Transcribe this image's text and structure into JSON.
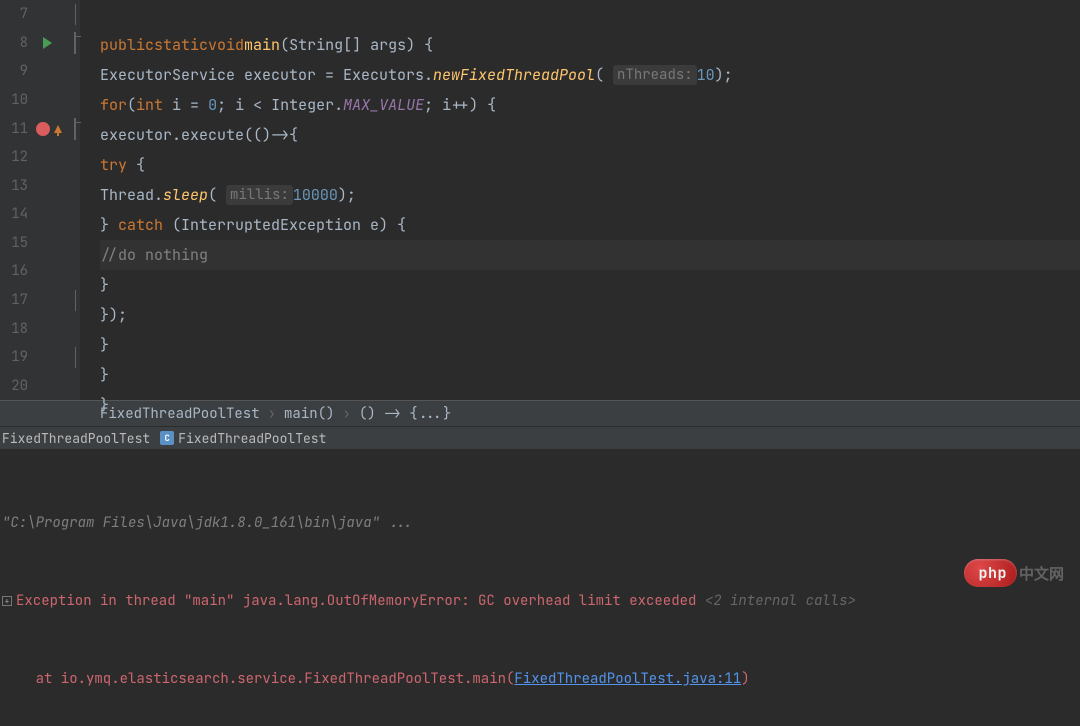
{
  "lines": {
    "7": "",
    "8": "",
    "9": "",
    "10": "",
    "11": "",
    "12": "",
    "13": "",
    "14": "",
    "15": "",
    "16": "",
    "17": "",
    "18": "",
    "19": "",
    "20": ""
  },
  "code": {
    "l8": {
      "kw1": "public",
      "kw2": "static",
      "kw3": "void",
      "method": "main",
      "params": "(String[] args) {"
    },
    "l9": {
      "pre": "ExecutorService executor = Executors.",
      "call": "newFixedThreadPool",
      "hint": "nThreads:",
      "val": "10",
      "post": ");"
    },
    "l10": {
      "kw": "for",
      "p1": "(",
      "t": "int",
      "init": " i = ",
      "zero": "0",
      "sc": ";",
      "cond": " i < Integer.",
      "max": "MAX_VALUE",
      "sc2": ";",
      "inc": " i++) {"
    },
    "l11": {
      "pre": "executor.execute(()->{"
    },
    "l12": {
      "kw": "try",
      "br": " {"
    },
    "l13": {
      "cls": "Thread.",
      "m": "sleep",
      "hint": "millis:",
      "val": "10000",
      "post": ");"
    },
    "l14": {
      "br": "} ",
      "kw": "catch",
      "param": " (InterruptedException e) {"
    },
    "l15": {
      "comment": "//do nothing"
    },
    "l16": {
      "br": "}"
    },
    "l17": {
      "br": "});"
    },
    "l18": {
      "br": "}"
    },
    "l19": {
      "br": "}"
    },
    "l20": {
      "br": "}"
    }
  },
  "breadcrumb": {
    "c1": "FixedThreadPoolTest",
    "c2": "main()",
    "c3": "() -> {...}"
  },
  "tabs": {
    "t1": "FixedThreadPoolTest",
    "t2": "FixedThreadPoolTest"
  },
  "console": {
    "cmd": "\"C:\\Program Files\\Java\\jdk1.8.0_161\\bin\\java\" ...",
    "err1a": "Exception in thread \"main\" java.lang.OutOfMemoryError: GC overhead limit exceeded ",
    "err1b": "<2 internal calls>",
    "err2a": "    at io.ymq.elasticsearch.service.FixedThreadPoolTest.main(",
    "err2link": "FixedThreadPoolTest.java:11",
    "err2b": ")"
  },
  "watermark": {
    "main": "php",
    "tail": "中文网"
  }
}
